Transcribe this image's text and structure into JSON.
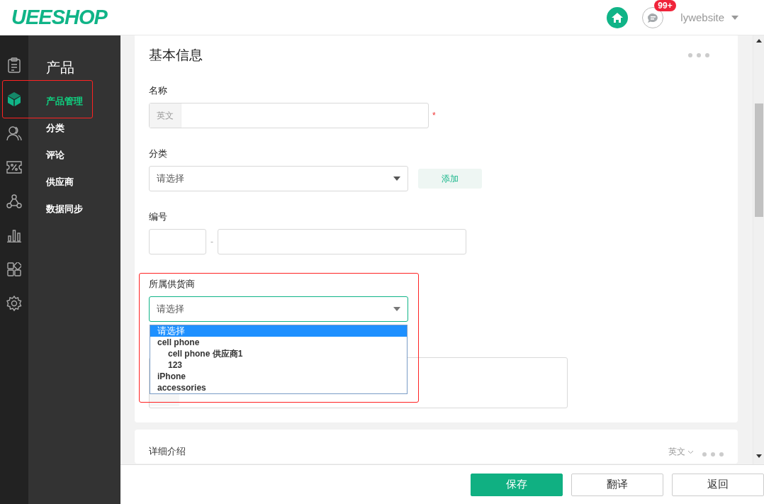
{
  "header": {
    "logo": "UEESHOP",
    "badge": "99+",
    "user": "lywebsite"
  },
  "rail_items": [
    {
      "kind": "clipboard",
      "selected": false
    },
    {
      "kind": "cube",
      "selected": true
    },
    {
      "kind": "users",
      "selected": false
    },
    {
      "kind": "coupon",
      "selected": false
    },
    {
      "kind": "nodes",
      "selected": false
    },
    {
      "kind": "chart",
      "selected": false
    },
    {
      "kind": "apps",
      "selected": false
    },
    {
      "kind": "gear",
      "selected": false
    }
  ],
  "submenu": {
    "title": "产品",
    "items": [
      {
        "label": "产品管理",
        "selected": true
      },
      {
        "label": "分类",
        "selected": false
      },
      {
        "label": "评论",
        "selected": false
      },
      {
        "label": "供应商",
        "selected": false
      },
      {
        "label": "数据同步",
        "selected": false
      }
    ]
  },
  "basic_info": {
    "title": "基本信息",
    "name": {
      "label": "名称",
      "prefix": "英文",
      "required_mark": "*"
    },
    "category": {
      "label": "分类",
      "value": "请选择",
      "add_button": "添加"
    },
    "number": {
      "label": "编号",
      "separator": "-"
    },
    "supplier": {
      "label": "所属供货商",
      "value": "请选择",
      "options": [
        {
          "label": "请选择",
          "selected": true
        },
        {
          "label": "cell phone",
          "selected": false,
          "children": [
            {
              "label": "cell phone 供应商1",
              "selected": false
            },
            {
              "label": "123",
              "selected": false
            }
          ]
        },
        {
          "label": "iPhone",
          "selected": false
        },
        {
          "label": "accessories",
          "selected": false
        }
      ]
    }
  },
  "detail": {
    "title": "详细介绍",
    "language": "英文"
  },
  "buttons": [
    {
      "label": "保存",
      "kind": "primary"
    },
    {
      "label": "翻译",
      "kind": "plain"
    },
    {
      "label": "返回",
      "kind": "plain"
    }
  ]
}
